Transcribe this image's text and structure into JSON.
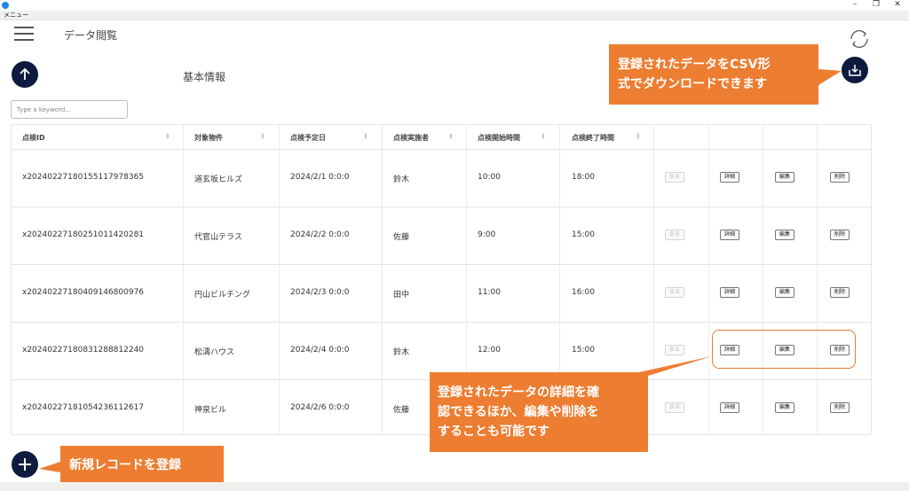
{
  "window": {
    "menu_label": "メニュー",
    "minimize_icon": "minimize-icon",
    "maximize_icon": "maximize-icon",
    "close_icon": "close-icon"
  },
  "header": {
    "page_title": "データ閲覧",
    "section_title": "基本情報"
  },
  "search": {
    "placeholder": "Type a keyword..."
  },
  "table": {
    "columns": [
      "点検ID",
      "対象物件",
      "点検予定日",
      "点検実施者",
      "点検開始時間",
      "点検終了時間"
    ],
    "actions": {
      "return": "戻る",
      "detail": "詳細",
      "edit": "編集",
      "delete": "削除"
    },
    "rows": [
      [
        "x20240227180155117978365",
        "道玄坂ヒルズ",
        "2024/2/1 0:0:0",
        "鈴木",
        "10:00",
        "18:00"
      ],
      [
        "x20240227180251011420281",
        "代官山テラス",
        "2024/2/2 0:0:0",
        "佐藤",
        "9:00",
        "15:00"
      ],
      [
        "x20240227180409146800976",
        "円山ビルチング",
        "2024/2/3 0:0:0",
        "田中",
        "11:00",
        "16:00"
      ],
      [
        "x20240227180831288812240",
        "松濤ハウス",
        "2024/2/4 0:0:0",
        "鈴木",
        "12:00",
        "15:00"
      ],
      [
        "x20240227181054236112617",
        "神泉ビル",
        "2024/2/6 0:0:0",
        "佐藤",
        "",
        ""
      ]
    ]
  },
  "callouts": {
    "csv": [
      "登録されたデータをCSV形",
      "式でダウンロードできます"
    ],
    "detail": [
      "登録されたデータの詳細を確",
      "認できるほか、編集や削除を",
      "することも可能です"
    ],
    "new_record": "新規レコードを登録"
  },
  "colors": {
    "callout": "#ed7d31",
    "navy": "#0d1b3e"
  }
}
